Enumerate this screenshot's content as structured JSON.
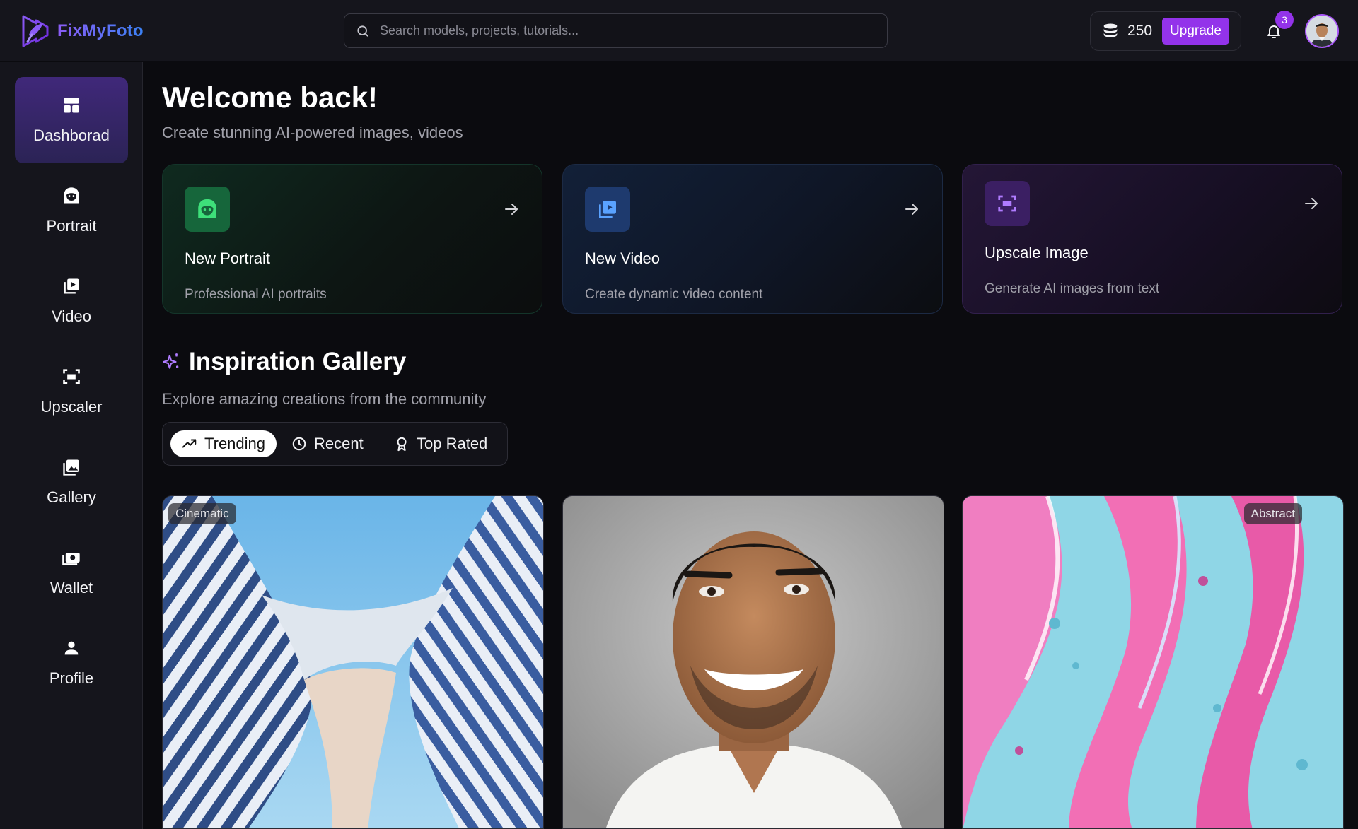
{
  "brand": {
    "name": "FixMyFoto"
  },
  "search": {
    "placeholder": "Search models, projects, tutorials..."
  },
  "credits": {
    "value": "250",
    "upgrade_label": "Upgrade"
  },
  "notifications": {
    "count": "3"
  },
  "sidebar": {
    "items": [
      {
        "label": "Dashborad",
        "icon": "dashboard-icon",
        "active": true
      },
      {
        "label": "Portrait",
        "icon": "portrait-icon"
      },
      {
        "label": "Video",
        "icon": "video-icon"
      },
      {
        "label": "Upscaler",
        "icon": "upscale-icon"
      },
      {
        "label": "Gallery",
        "icon": "gallery-icon"
      },
      {
        "label": "Wallet",
        "icon": "wallet-icon"
      },
      {
        "label": "Profile",
        "icon": "profile-icon"
      }
    ]
  },
  "welcome": {
    "title": "Welcome back!",
    "subtitle": "Create stunning AI-powered images, videos"
  },
  "cards": [
    {
      "title": "New Portrait",
      "description": "Professional AI portraits",
      "icon": "portrait-icon",
      "accent": "#22c55e"
    },
    {
      "title": "New Video",
      "description": "Create dynamic video content",
      "icon": "video-icon",
      "accent": "#3b82f6"
    },
    {
      "title": "Upscale Image",
      "description": "Generate AI images from text",
      "icon": "upscale-icon",
      "accent": "#a855f7"
    }
  ],
  "gallery": {
    "title": "Inspiration Gallery",
    "subtitle": "Explore amazing creations from the community",
    "filters": [
      {
        "label": "Trending",
        "icon": "trending-icon",
        "active": true
      },
      {
        "label": "Recent",
        "icon": "clock-icon"
      },
      {
        "label": "Top Rated",
        "icon": "award-icon"
      }
    ],
    "items": [
      {
        "tag": "Cinematic",
        "subject": "architecture"
      },
      {
        "tag": "",
        "subject": "portrait"
      },
      {
        "tag": "Abstract",
        "subject": "fluid-art"
      }
    ]
  },
  "colors": {
    "accent": "#9333ea",
    "background": "#0b0b0f",
    "panel": "#15151c"
  }
}
